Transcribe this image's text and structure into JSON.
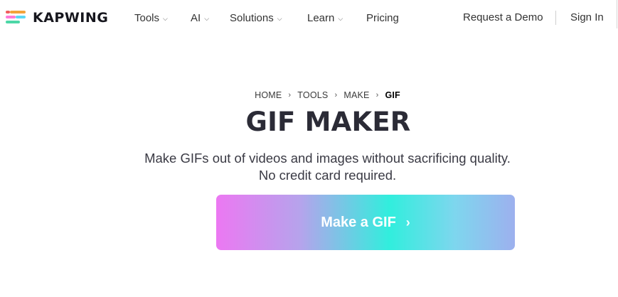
{
  "nav": {
    "logo_text": "KAPWING",
    "items": [
      {
        "label": "Tools",
        "has_dropdown": true
      },
      {
        "label": "AI",
        "has_dropdown": true
      },
      {
        "label": "Solutions",
        "has_dropdown": true
      },
      {
        "label": "Learn",
        "has_dropdown": true
      },
      {
        "label": "Pricing",
        "has_dropdown": false
      }
    ],
    "request_demo": "Request a Demo",
    "sign_in": "Sign In"
  },
  "breadcrumb": {
    "items": [
      "HOME",
      "TOOLS",
      "MAKE"
    ],
    "current": "GIF"
  },
  "hero": {
    "title": "GIF MAKER",
    "subtitle_line1": "Make GIFs out of videos and images without sacrificing quality.",
    "subtitle_line2": "No credit card required.",
    "cta_label": "Make a GIF"
  },
  "colors": {
    "cta_gradient": [
      "#ec78f2",
      "#b6a3ec",
      "#31eedd",
      "#7ed6ee",
      "#9db0ee"
    ],
    "title_color": "#2b2b36"
  },
  "icons": {
    "dropdown": "chevron-down-icon",
    "breadcrumb_separator": "chevron-right-icon",
    "cta_arrow": "chevron-right-icon"
  }
}
